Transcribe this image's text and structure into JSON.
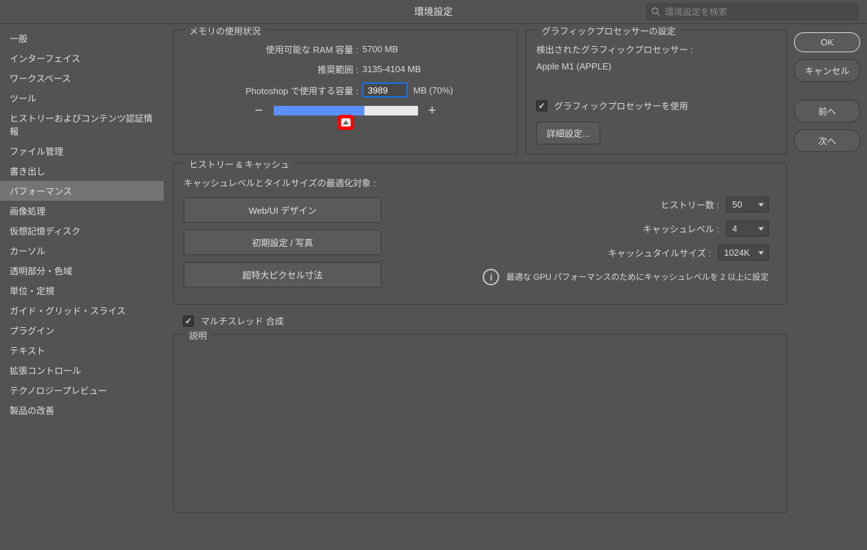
{
  "window": {
    "title": "環境設定",
    "search_placeholder": "環境設定を検索"
  },
  "sidebar": {
    "items": [
      "一般",
      "インターフェイス",
      "ワークスペース",
      "ツール",
      "ヒストリーおよびコンテンツ認証情報",
      "ファイル管理",
      "書き出し",
      "パフォーマンス",
      "画像処理",
      "仮想記憶ディスク",
      "カーソル",
      "透明部分・色域",
      "単位・定規",
      "ガイド・グリッド・スライス",
      "プラグイン",
      "テキスト",
      "拡張コントロール",
      "テクノロジープレビュー",
      "製品の改善"
    ],
    "selected_index": 7
  },
  "memory": {
    "legend": "メモリの使用状況",
    "available_label": "使用可能な RAM 容量 :",
    "available_value": "5700 MB",
    "ideal_label": "推奨範囲 :",
    "ideal_value": "3135-4104 MB",
    "use_label": "Photoshop で使用する容量 :",
    "use_value": "3989",
    "use_suffix": "MB (70%)",
    "minus": "−",
    "plus": "+"
  },
  "gpu": {
    "legend": "グラフィックプロセッサーの設定",
    "detected_label": "検出されたグラフィックプロセッサー :",
    "detected_value": "Apple M1 (APPLE)",
    "use_gpu_label": "グラフィックプロセッサーを使用",
    "use_gpu_checked": true,
    "advanced_button": "詳細設定..."
  },
  "history": {
    "legend": "ヒストリー & キャッシュ",
    "optimize_label": "キャッシュレベルとタイルサイズの最適化対象 :",
    "buttons": [
      "Web/UI デザイン",
      "初期設定 / 写真",
      "超特大ピクセル寸法"
    ],
    "history_states_label": "ヒストリー数 :",
    "history_states_value": "50",
    "cache_levels_label": "キャッシュレベル :",
    "cache_levels_value": "4",
    "cache_tile_label": "キャッシュタイルサイズ :",
    "cache_tile_value": "1024K",
    "info_text": "最適な GPU パフォーマンスのためにキャッシュレベルを 2 以上に設定"
  },
  "multithread": {
    "label": "マルチスレッド 合成",
    "checked": true
  },
  "description": {
    "legend": "説明"
  },
  "buttons": {
    "ok": "OK",
    "cancel": "キャンセル",
    "prev": "前へ",
    "next": "次へ"
  }
}
